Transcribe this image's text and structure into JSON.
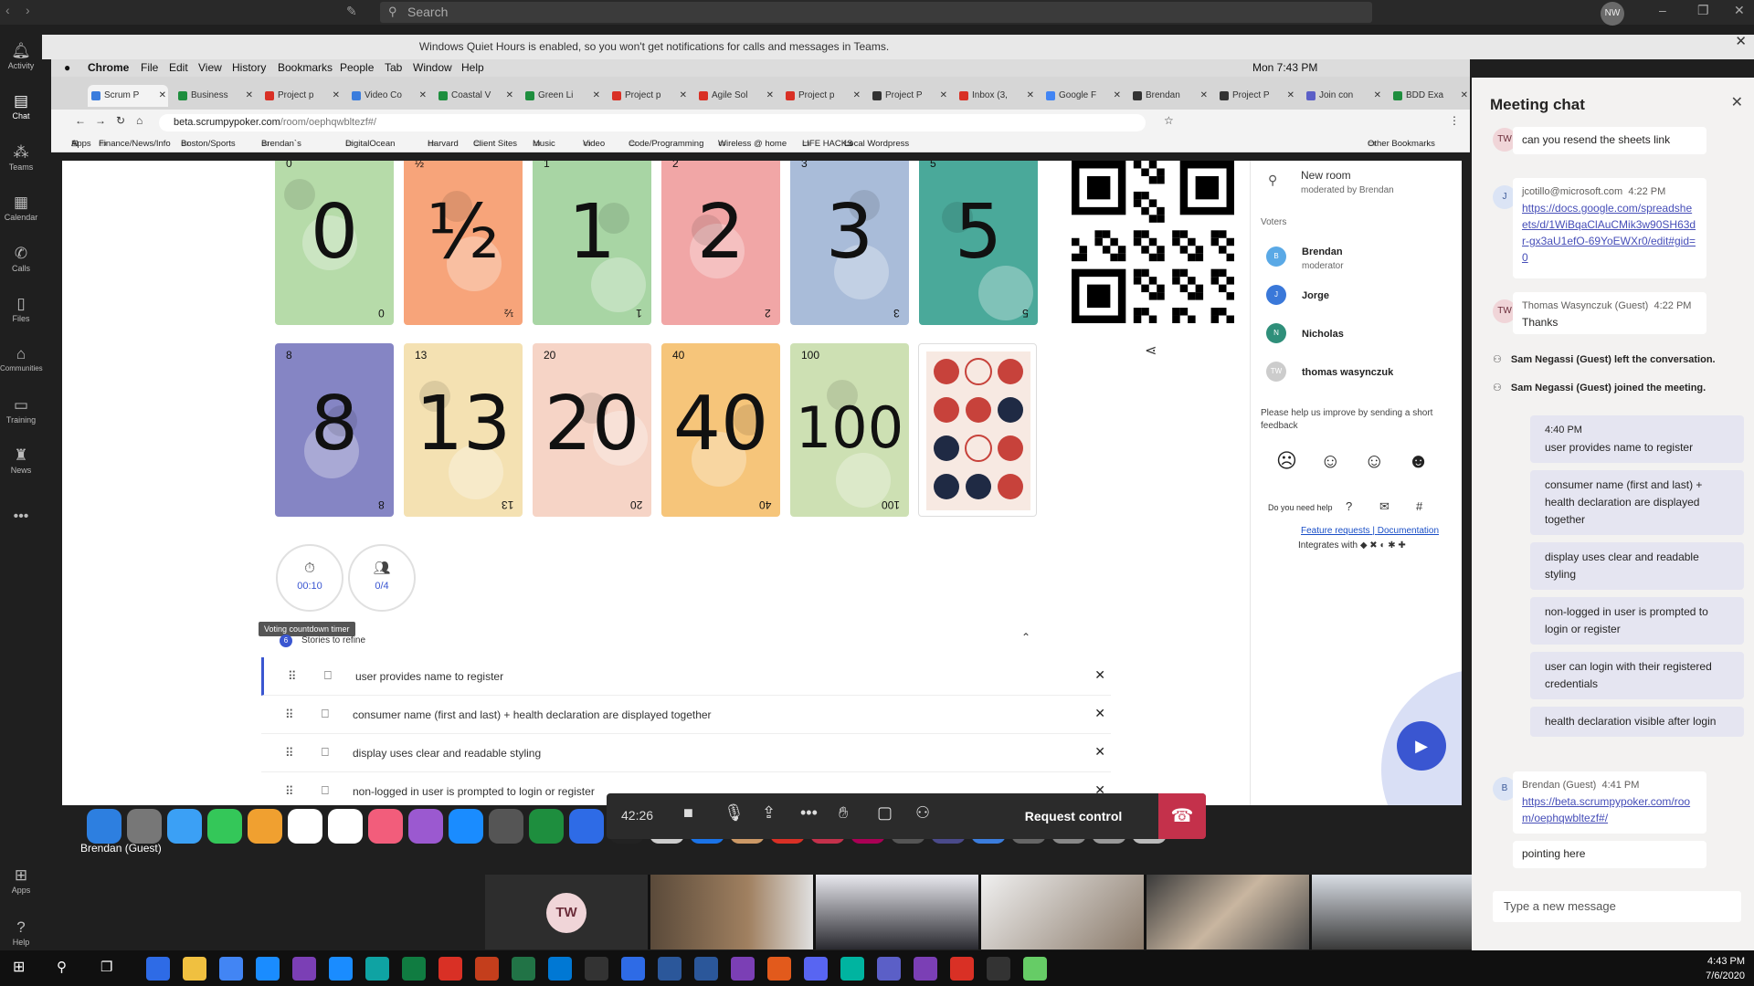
{
  "teams": {
    "search_placeholder": "Search",
    "user_initials": "NW",
    "quiet_banner": "Windows Quiet Hours is enabled, so you won't get notifications for calls and messages in Teams.",
    "rail": [
      {
        "label": "Activity",
        "icon": "bell-icon"
      },
      {
        "label": "Chat",
        "icon": "chat-icon"
      },
      {
        "label": "Teams",
        "icon": "teams-icon"
      },
      {
        "label": "Calendar",
        "icon": "calendar-icon"
      },
      {
        "label": "Calls",
        "icon": "phone-icon"
      },
      {
        "label": "Files",
        "icon": "file-icon"
      },
      {
        "label": "Communities",
        "icon": "communities-icon"
      },
      {
        "label": "Training",
        "icon": "training-icon"
      },
      {
        "label": "News",
        "icon": "news-icon"
      },
      {
        "label": "Apps",
        "icon": "apps-icon"
      },
      {
        "label": "Help",
        "icon": "help-icon"
      }
    ]
  },
  "mac": {
    "menu": [
      "Chrome",
      "File",
      "Edit",
      "View",
      "History",
      "Bookmarks",
      "People",
      "Tab",
      "Window",
      "Help"
    ],
    "clock": "Mon 7:43 PM"
  },
  "chrome": {
    "tabs": [
      "Scrum P",
      "Business",
      "Project p",
      "Video Co",
      "Coastal V",
      "Green Li",
      "Project p",
      "Agile Sol",
      "Project p",
      "Project P",
      "Inbox (3,",
      "Google F",
      "Brendan",
      "Project P",
      "Join con",
      "BDD Exa"
    ],
    "url_host": "beta.scrumpypoker.com",
    "url_path": "/room/oephqwbltezf#/",
    "bookmarks": [
      "Apps",
      "Finance/News/Info",
      "Boston/Sports",
      "Brendan`s",
      "DigitalOcean",
      "Harvard",
      "Client Sites",
      "Music",
      "Video",
      "Code/Programming",
      "Wireless @ home",
      "LIFE HACKS",
      "Local Wordpress",
      "Other Bookmarks"
    ]
  },
  "poker": {
    "cards": [
      {
        "value": "0",
        "color": "#b6dba9"
      },
      {
        "value": "½",
        "color": "#f7a47a"
      },
      {
        "value": "1",
        "color": "#a8d5a4"
      },
      {
        "value": "2",
        "color": "#f1a6a6"
      },
      {
        "value": "3",
        "color": "#a9bcd9"
      },
      {
        "value": "5",
        "color": "#4aa99a"
      },
      {
        "value": "8",
        "color": "#8585c4"
      },
      {
        "value": "13",
        "color": "#f4e1b2"
      },
      {
        "value": "20",
        "color": "#f6d4c6"
      },
      {
        "value": "40",
        "color": "#f6c57a"
      },
      {
        "value": "100",
        "color": "#cde0b3"
      }
    ],
    "timer_value": "00:10",
    "players_value": "0/4",
    "tooltip": "Voting countdown timer",
    "stories_count": "6",
    "stories_header": "Stories to refine",
    "stories": [
      "user provides name to register",
      "consumer name (first and last) + health declaration are displayed together",
      "display uses clear and readable styling",
      "non-logged in user is prompted to login or register"
    ],
    "room": {
      "name": "New room",
      "moderator": "moderated by Brendan",
      "voters_label": "Voters",
      "voters": [
        {
          "initial": "B",
          "name": "Brendan",
          "role": "moderator",
          "color": "#5aa9e6"
        },
        {
          "initial": "J",
          "name": "Jorge",
          "role": "",
          "color": "#3a78d9"
        },
        {
          "initial": "N",
          "name": "Nicholas",
          "role": "",
          "color": "#2f8f7a"
        },
        {
          "initial": "TW",
          "name": "thomas wasynczuk",
          "role": "",
          "color": "#cccccc"
        }
      ],
      "feedback": "Please help us improve by sending a short feedback",
      "help": "Do you need help",
      "feature_requests": "Feature requests",
      "documentation": "Documentation",
      "integrates": "Integrates with"
    }
  },
  "call": {
    "duration": "42:26",
    "request_control": "Request control",
    "presenter": "Brendan (Guest)",
    "participant_initials": "TW"
  },
  "chat": {
    "title": "Meeting chat",
    "messages": [
      {
        "initials": "TW",
        "text": "can you resend the sheets link"
      },
      {
        "initials": "J",
        "author": "jcotillo@microsoft.com",
        "time": "4:22 PM",
        "link": "https://docs.google.com/spreadsheets/d/1WiBqaClAuCMik3w90SH63dr-gx3aU1efO-69YoEWXr0/edit#gid=0"
      },
      {
        "initials": "TW",
        "author": "Thomas Wasynczuk (Guest)",
        "time": "4:22 PM",
        "text": "Thanks"
      }
    ],
    "system": [
      "Sam Negassi (Guest) left the conversation.",
      "Sam Negassi (Guest) joined the meeting."
    ],
    "mine_time": "4:40 PM",
    "mine": [
      "user provides name to register",
      "consumer name (first and last) + health declaration are displayed together",
      "display uses clear and readable styling",
      "non-logged in user is prompted to login or register",
      "user can login with their registered credentials",
      "health declaration visible after login"
    ],
    "last": {
      "initials": "B",
      "author": "Brendan (Guest)",
      "time": "4:41 PM",
      "link": "https://beta.scrumpypoker.com/room/oephqwbltezf#/",
      "text": "pointing here"
    },
    "compose_placeholder": "Type a new message"
  },
  "windows": {
    "time": "4:43 PM",
    "date": "7/6/2020"
  }
}
